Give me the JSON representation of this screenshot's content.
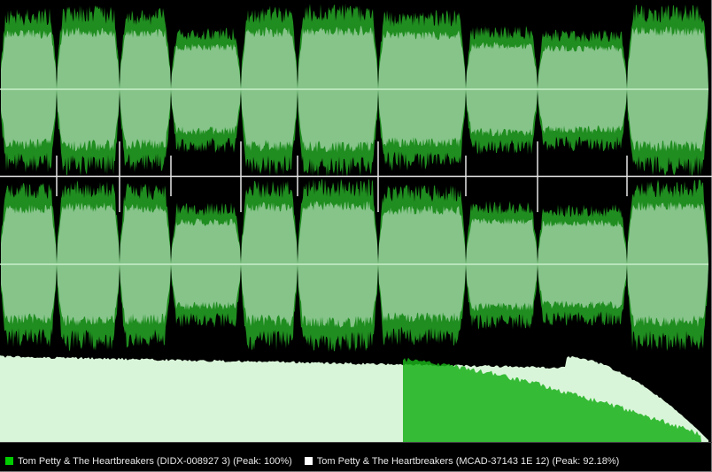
{
  "colors": {
    "background": "#000000",
    "wave_outer": "#1f8d1f",
    "wave_inner": "#86c48a",
    "center_line": "#c9f0c9",
    "divider": "#e6e6e6",
    "spectrum_base": "#d9f5d9",
    "spectrum_overlay": "#19b019"
  },
  "tracks": 10,
  "legend": {
    "entries": [
      {
        "label": "Tom Petty & The Heartbreakers (DIDX-008927 3) (Peak: 100%)",
        "color": "#00cc00"
      },
      {
        "label": "Tom Petty & The Heartbreakers (MCAD-37143 1E 12) (Peak: 92.18%)",
        "color": "#ffffff"
      }
    ]
  }
}
